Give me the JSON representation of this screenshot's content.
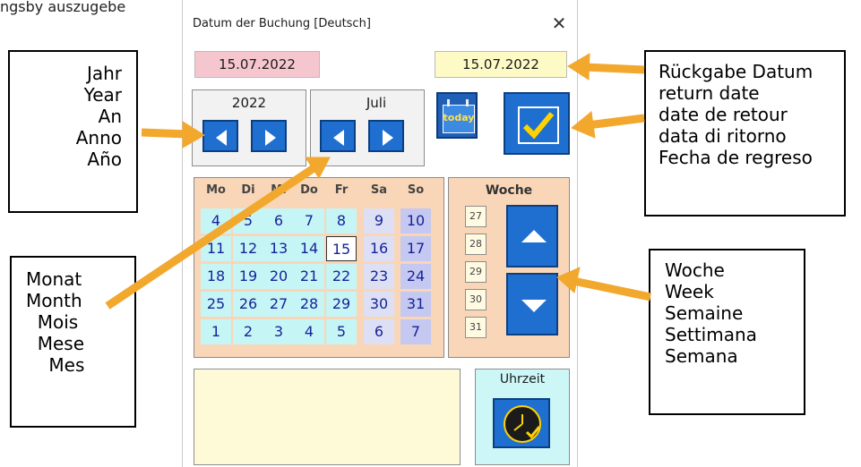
{
  "cut_text": "ngsby auszugebe",
  "dialog": {
    "title": "Datum der Buchung   [Deutsch]",
    "close_symbol": "✕",
    "date_left": "15.07.2022",
    "date_right": "15.07.2022",
    "year": "2022",
    "month": "Juli",
    "today_label": "today",
    "weekdays": [
      "Mo",
      "Di",
      "Mi",
      "Do",
      "Fr",
      "Sa",
      "So"
    ],
    "calendar_rows": [
      [
        "4",
        "5",
        "6",
        "7",
        "8",
        "9",
        "10"
      ],
      [
        "11",
        "12",
        "13",
        "14",
        "15",
        "16",
        "17"
      ],
      [
        "18",
        "19",
        "20",
        "21",
        "22",
        "23",
        "24"
      ],
      [
        "25",
        "26",
        "27",
        "28",
        "29",
        "30",
        "31"
      ],
      [
        "1",
        "2",
        "3",
        "4",
        "5",
        "6",
        "7"
      ]
    ],
    "selected_day": "15",
    "week_title": "Woche",
    "weeks": [
      "27",
      "28",
      "29",
      "30",
      "31"
    ],
    "time_label": "Uhrzeit"
  },
  "callouts": {
    "year": "Jahr\nYear\nAn\nAnno\nAño",
    "month": "Monat\nMonth\n  Mois\n  Mese\n    Mes",
    "return": "Rückgabe Datum\nreturn date\ndate de retour\ndata di ritorno\nFecha de regreso",
    "week": "Woche\nWeek\nSemaine\nSettimana\nSemana"
  },
  "colors": {
    "button_blue": "#1e6fd0",
    "arrow_orange": "#f2a72d",
    "date_pink": "#f6c6cf",
    "date_yellow": "#fefac6",
    "panel_peach": "#f9d6b7"
  }
}
